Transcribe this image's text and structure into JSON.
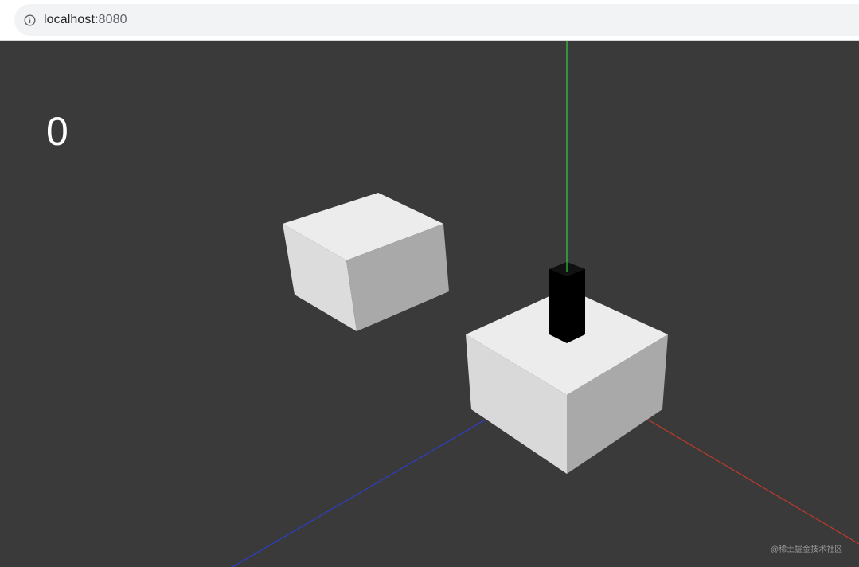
{
  "browser": {
    "url_host": "localhost",
    "url_port": ":8080",
    "info_icon": "info-icon"
  },
  "game": {
    "score": "0",
    "colors": {
      "background": "#3a3a3a",
      "axis_x": "#c0392b",
      "axis_y": "#2ecc40",
      "axis_z": "#2c3ec9",
      "box_top": "#ececec",
      "box_left": "#d9d9d9",
      "box_right": "#a9a9a9",
      "player": "#000000"
    },
    "objects": [
      "cube-left",
      "cube-center",
      "player-pillar"
    ]
  },
  "watermark": "@稀土掘金技术社区"
}
